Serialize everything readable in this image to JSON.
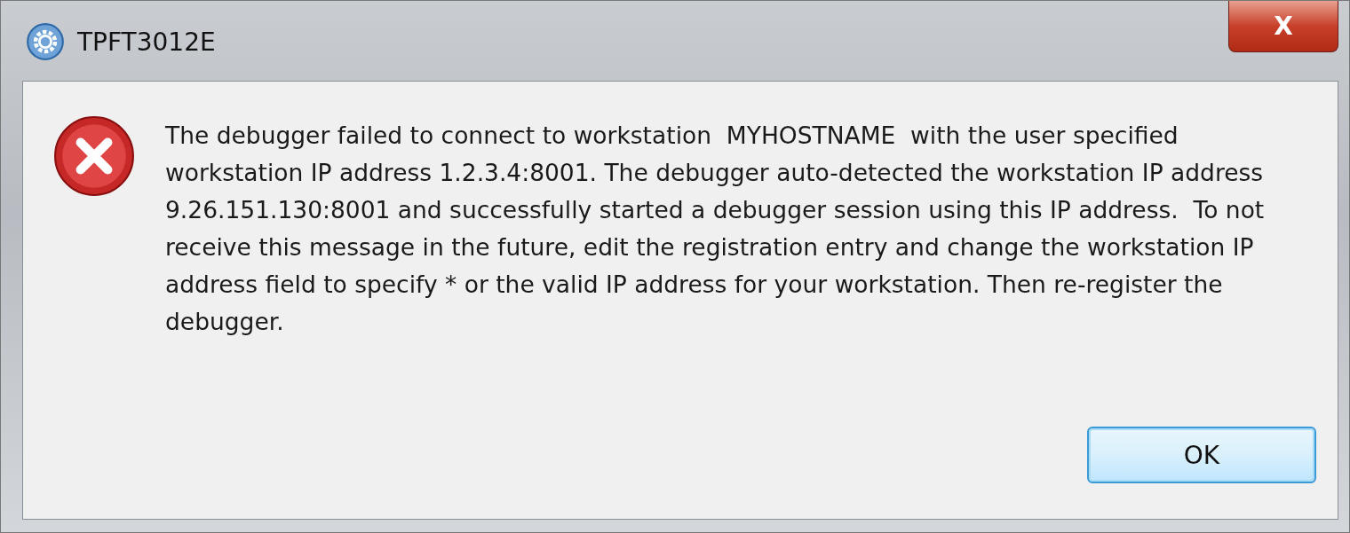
{
  "window": {
    "title": "TPFT3012E",
    "close_label": "X"
  },
  "message": "The debugger failed to connect to workstation  MYHOSTNAME  with the user specified workstation IP address 1.2.3.4:8001. The debugger auto-detected the workstation IP address 9.26.151.130:8001 and successfully started a debugger session using this IP address.  To not receive this message in the future, edit the registration entry and change the workstation IP address field to specify * or the valid IP address for your workstation. Then re-register the debugger.",
  "buttons": [
    {
      "label": "OK",
      "default": true
    }
  ]
}
